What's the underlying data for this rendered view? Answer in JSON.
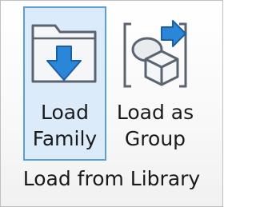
{
  "ribbon_panel": {
    "title": "Load from Library",
    "buttons": [
      {
        "label_line1": "Load",
        "label_line2": "Family",
        "icon": "folder-download-icon",
        "state": "selected"
      },
      {
        "label_line1": "Load as",
        "label_line2": "Group",
        "icon": "group-cubes-icon",
        "state": "normal"
      }
    ]
  },
  "colors": {
    "selected_background": "#dcebfa",
    "selected_border": "#5c9ed6",
    "accent_blue": "#2a86d8"
  }
}
